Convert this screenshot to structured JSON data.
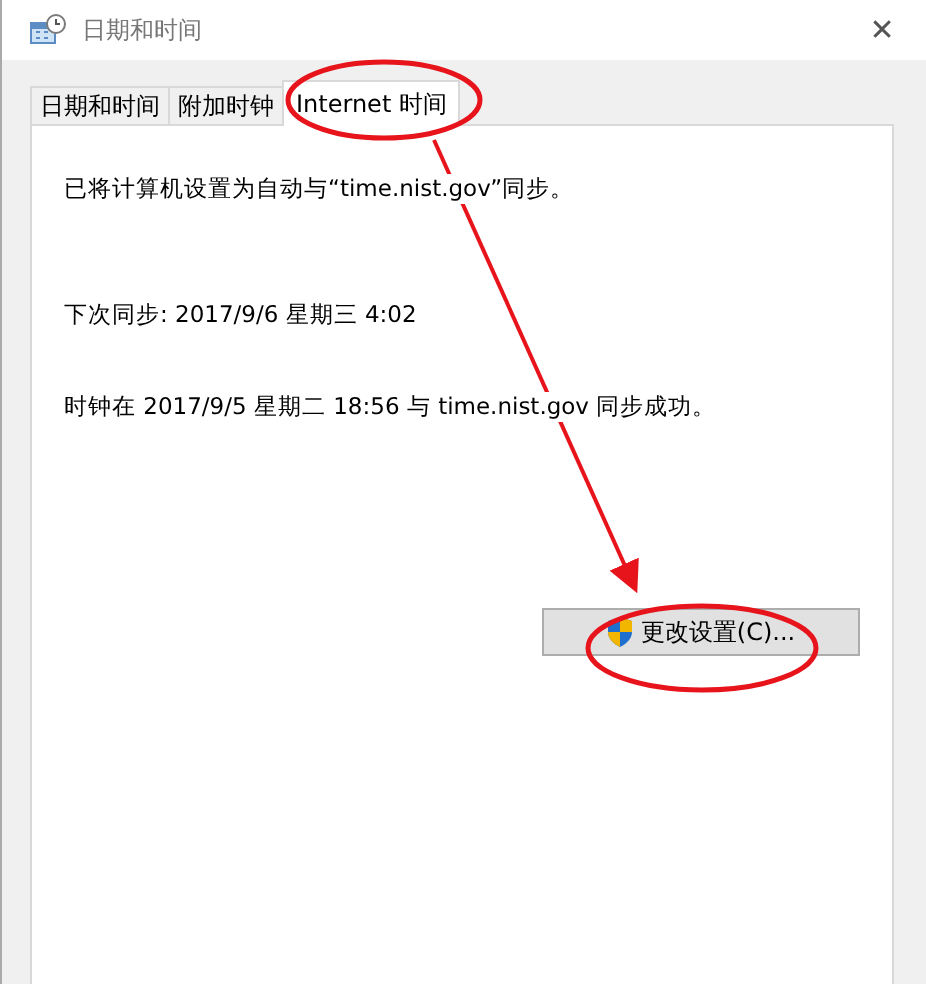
{
  "window": {
    "title": "日期和时间",
    "close": "✕"
  },
  "tabs": [
    {
      "label": "日期和时间",
      "selected": false
    },
    {
      "label": "附加时钟",
      "selected": false
    },
    {
      "label": "Internet 时间",
      "selected": true
    }
  ],
  "panel": {
    "lines": [
      "已将计算机设置为自动与“time.nist.gov”同步。",
      "下次同步: 2017/9/6 星期三 4:02",
      "时钟在 2017/9/5 星期二 18:56 与 time.nist.gov 同步成功。"
    ],
    "button": {
      "label": "更改设置(C)..."
    }
  }
}
